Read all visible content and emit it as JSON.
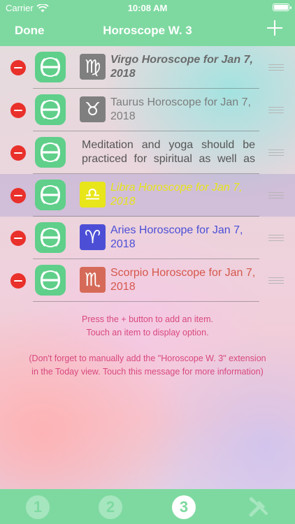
{
  "status_bar": {
    "carrier": "Carrier",
    "time": "10:08 AM"
  },
  "nav": {
    "done_label": "Done",
    "title": "Horoscope W. 3",
    "add_icon": "plus-icon"
  },
  "items": [
    {
      "title": "Virgo Horoscope for Jan 7, 2018",
      "sign_icon": "virgo-icon",
      "color": "#6a6a6a",
      "sign_bg": "#7f7f7f"
    },
    {
      "title": "Taurus Horoscope for Jan 7, 2018",
      "sign_icon": "taurus-icon",
      "color": "#7d7d7d",
      "sign_bg": "#7f7f7f"
    },
    {
      "title": "Meditation and yoga should be practiced for spiritual as well as",
      "sign_icon": "",
      "color": "#555555"
    },
    {
      "title": "Libra Horoscope for Jan 7, 2018",
      "sign_icon": "libra-icon",
      "color": "#e8e51a",
      "sign_bg": "#e8e51a"
    },
    {
      "title": "Aries Horoscope for Jan 7, 2018",
      "sign_icon": "aries-icon",
      "color": "#4c4fd6",
      "sign_bg": "#4c4fd6"
    },
    {
      "title": "Scorpio Horoscope for Jan 7, 2018",
      "sign_icon": "scorpio-icon",
      "color": "#d6574c",
      "sign_bg": "#d66a58"
    }
  ],
  "hints": {
    "line1": "Press the + button to add an item.",
    "line2": "Touch an item to display option.",
    "line3": "(Don't forget to manually add the \"Horoscope W. 3\" extension",
    "line4": "in the Today view. Touch this message for more information)"
  },
  "tabs": [
    {
      "label": "1"
    },
    {
      "label": "2"
    },
    {
      "label": "3"
    },
    {
      "icon": "tools-icon"
    }
  ],
  "colors": {
    "accent": "#7ed9a0",
    "delete": "#e9302a",
    "hint": "#d8487e"
  }
}
